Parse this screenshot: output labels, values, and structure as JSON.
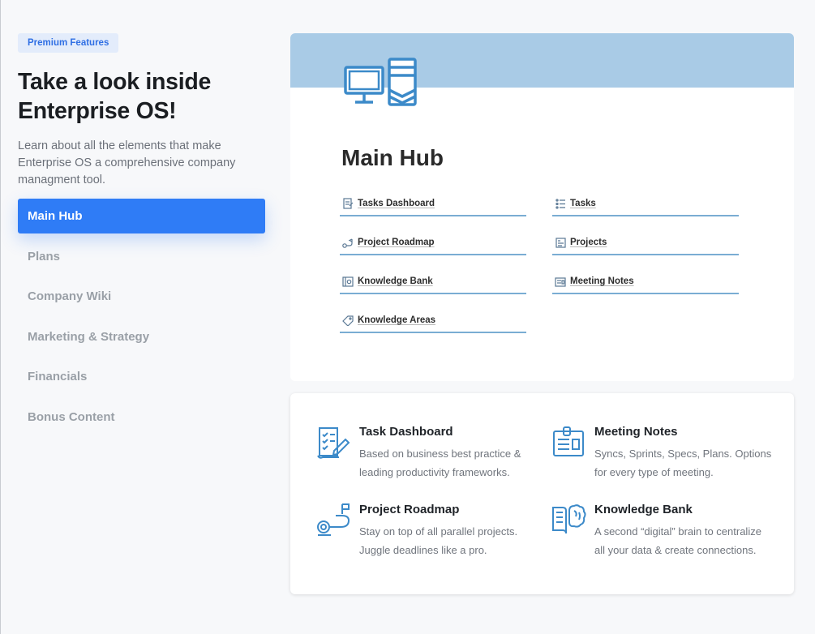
{
  "badge": "Premium Features",
  "headline": "Take a look inside Enterprise OS!",
  "lede": "Learn about all the elements that make Enterprise OS a comprehensive company managment tool.",
  "nav": [
    {
      "label": "Main Hub",
      "active": true
    },
    {
      "label": "Plans"
    },
    {
      "label": "Company Wiki"
    },
    {
      "label": "Marketing & Strategy"
    },
    {
      "label": "Financials"
    },
    {
      "label": "Bonus Content"
    }
  ],
  "hub": {
    "title": "Main Hub",
    "icon": "computer-server-icon",
    "links": [
      {
        "label": "Tasks Dashboard",
        "icon": "dashboard-doc-icon"
      },
      {
        "label": "Tasks",
        "icon": "list-icon"
      },
      {
        "label": "Project Roadmap",
        "icon": "roadmap-icon"
      },
      {
        "label": "Projects",
        "icon": "projects-icon"
      },
      {
        "label": "Knowledge Bank",
        "icon": "knowledge-bank-icon"
      },
      {
        "label": "Meeting Notes",
        "icon": "meeting-notes-icon"
      },
      {
        "label": "Knowledge Areas",
        "icon": "tag-icon"
      }
    ]
  },
  "features": [
    {
      "title": "Task Dashboard",
      "desc": "Based on business best practice & leading productivity frameworks.",
      "icon": "task-checklist-icon"
    },
    {
      "title": "Meeting Notes",
      "desc": "Syncs, Sprints, Specs, Plans. Options for every type of meeting.",
      "icon": "clipboard-icon"
    },
    {
      "title": "Project Roadmap",
      "desc": "Stay on top of all parallel projects. Juggle deadlines like a pro.",
      "icon": "roadmap-path-icon"
    },
    {
      "title": "Knowledge Bank",
      "desc": "A second “digital” brain to centralize all your data & create connections.",
      "icon": "book-brain-icon"
    }
  ],
  "colors": {
    "accent": "#2f7cf6",
    "banner": "#a9cbe6",
    "link_underline": "#7aadd3",
    "icon_blue": "#3c8ac9"
  }
}
